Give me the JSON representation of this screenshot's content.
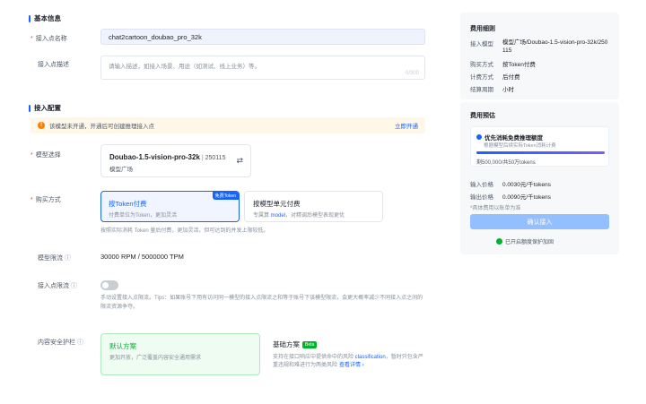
{
  "basic": {
    "title": "基本信息",
    "name_label": "接入点名称",
    "name_value": "chat2cartoon_doubao_pro_32k",
    "desc_label": "接入点描述",
    "desc_placeholder": "请输入描述，如接入场景、用途（如测试、线上业务）等。",
    "desc_counter": "0/300"
  },
  "config": {
    "title": "接入配置",
    "warning_text": "该模型未开通，开通后可创建推理接入点",
    "warning_link": "立即开通",
    "model_label": "模型选择",
    "model_name": "Doubao-1.5-vision-pro-32k",
    "model_version": "250115",
    "model_source": "模型广场",
    "purchase_label": "购买方式",
    "options": [
      {
        "title": "按Token付费",
        "desc": "付费单位为Token，更加灵活",
        "badge": "免费Token"
      },
      {
        "title": "按模型单元付费",
        "desc_pre": "专属算 ",
        "desc_link": "model",
        "desc_post": "，对精调后模型表现更优"
      }
    ],
    "purchase_hint": "按照实际消耗 Token 量后付费，更加灵活，但可达到的并发上限较低。",
    "rate_label": "模型限流",
    "rate_value": "30000 RPM / 5000000 TPM",
    "limit_label": "接入点限流",
    "limit_hint": "手动设置接入点限流。Tips：如果账号下用有访问同一模型的接入点限流之和等于账号下该模型限流，会更大概率减少不同接入点之间的限流资源争夺。",
    "safety_label": "内容安全护栏",
    "safety_options": [
      {
        "title": "默认方案",
        "desc": "更加开放，广泛覆盖内容安全通用需求"
      },
      {
        "title": "基础方案",
        "badge": "Beta",
        "desc_pre": "支持在接口响应中提供命中的风险 ",
        "desc_link": "classification",
        "desc_post": "，暂时只包含严重违规和难进行为两类风险",
        "more_link": "查看详情 ›"
      }
    ]
  },
  "side": {
    "fee_title": "费用细则",
    "fee_rows": [
      {
        "k": "接入模型",
        "v": "模型广场/Doubao-1.5-vision-pro-32k/250115"
      },
      {
        "k": "购买方式",
        "v": "按Token付费"
      },
      {
        "k": "计费方式",
        "v": "后付费"
      },
      {
        "k": "结算周期",
        "v": "小时"
      }
    ],
    "estimate_title": "费用预估",
    "free_title": "优先消耗免费推理额度",
    "free_desc": "根据模型后续实际Token消耗计费",
    "free_progress_text": "剩500,000/共50万tokens",
    "free_progress": 1.0,
    "price_rows": [
      {
        "k": "输入价格",
        "v": "0.0030元/千tokens"
      },
      {
        "k": "输出价格",
        "v": "0.0090元/千tokens"
      }
    ],
    "price_note": "*具体费用以账单为准",
    "confirm_btn": "确认接入",
    "protect_text": "已开启额度保护加固",
    "accent": "#1664ff"
  }
}
